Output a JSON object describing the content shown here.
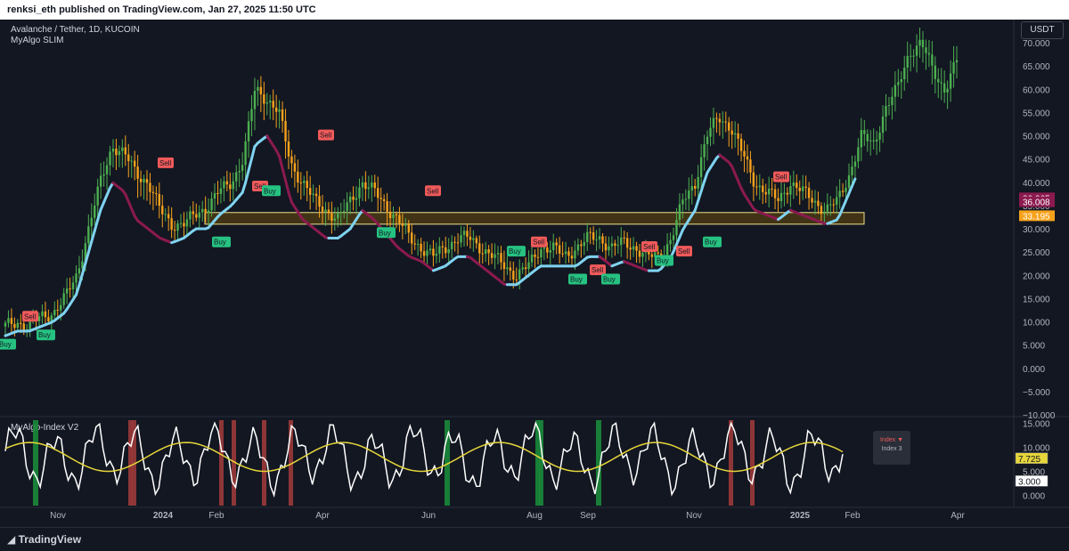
{
  "header": {
    "published": "renksi_eth published on TradingView.com, Jan 27, 2025 11:50 UTC"
  },
  "symbol": {
    "title": "Avalanche / Tether, 1D, KUCOIN",
    "indicator": "MyAlgo SLIM"
  },
  "currency_button": "USDT",
  "footer": {
    "brand": "TradingView"
  },
  "colors": {
    "bull": "#4caf50",
    "bear": "#f7a21b",
    "buy": "#26c281",
    "sell": "#f05a5a",
    "band_up": "#7fd3f0",
    "band_down": "#8b1a4f",
    "zone": "#4a3a14",
    "zone_border": "#f1e38d"
  },
  "chart_data": [
    {
      "type": "candlestick",
      "title": "Avalanche / Tether, 1D, KUCOIN",
      "ylim": [
        -10,
        75
      ],
      "y_ticks": [
        "70.000",
        "65.000",
        "60.000",
        "55.000",
        "50.000",
        "45.000",
        "40.000",
        "35.000",
        "30.000",
        "25.000",
        "20.000",
        "15.000",
        "10.000",
        "5.000",
        "0.000",
        "−5.000",
        "−10.000"
      ],
      "x_ticks": [
        "Nov",
        "2024",
        "Feb",
        "Apr",
        "Jun",
        "Aug",
        "Sep",
        "Nov",
        "2025",
        "Feb",
        "Apr"
      ],
      "price_labels": [
        {
          "value": 36.265,
          "text": "36.265",
          "color": "#8b1a4f"
        },
        {
          "value": 36.008,
          "text": "36.008",
          "color": "#8b1a4f"
        },
        {
          "value": 33.195,
          "text": "33.195",
          "color": "#f7a21b"
        }
      ],
      "support_zone": [
        31,
        33.5
      ],
      "signals": [
        {
          "label": "Sell",
          "x": 34,
          "price": 11
        },
        {
          "label": "Buy",
          "x": 50,
          "price": 7
        },
        {
          "label": "Buy",
          "x": 6,
          "price": 5
        },
        {
          "label": "Sell",
          "x": 186,
          "price": 44
        },
        {
          "label": "Buy",
          "x": 247,
          "price": 27
        },
        {
          "label": "Sell",
          "x": 292,
          "price": 39
        },
        {
          "label": "Buy",
          "x": 303,
          "price": 38
        },
        {
          "label": "Sell",
          "x": 366,
          "price": 50
        },
        {
          "label": "Buy",
          "x": 432,
          "price": 29
        },
        {
          "label": "Sell",
          "x": 486,
          "price": 38
        },
        {
          "label": "Buy",
          "x": 578,
          "price": 25
        },
        {
          "label": "Sell",
          "x": 605,
          "price": 27
        },
        {
          "label": "Buy",
          "x": 647,
          "price": 19
        },
        {
          "label": "Sell",
          "x": 671,
          "price": 21
        },
        {
          "label": "Buy",
          "x": 684,
          "price": 19
        },
        {
          "label": "Sell",
          "x": 729,
          "price": 26
        },
        {
          "label": "Buy",
          "x": 744,
          "price": 23
        },
        {
          "label": "Sell",
          "x": 768,
          "price": 25
        },
        {
          "label": "Buy",
          "x": 798,
          "price": 27
        },
        {
          "label": "Sell",
          "x": 877,
          "price": 41
        }
      ],
      "approx_closes": [
        9,
        10,
        9,
        11,
        12,
        15,
        20,
        30,
        40,
        48,
        46,
        42,
        40,
        34,
        31,
        31,
        33,
        35,
        38,
        40,
        45,
        60,
        58,
        55,
        44,
        40,
        36,
        34,
        32,
        36,
        40,
        38,
        35,
        32,
        28,
        26,
        24,
        26,
        28,
        28,
        26,
        24,
        22,
        20,
        22,
        26,
        26,
        24,
        26,
        28,
        28,
        26,
        27,
        26,
        24,
        24,
        28,
        36,
        40,
        50,
        54,
        52,
        46,
        40,
        38,
        36,
        40,
        38,
        36,
        34,
        36,
        42,
        50,
        48,
        56,
        60,
        68,
        70,
        64,
        60,
        66
      ],
      "approx_lows": [
        7,
        8,
        8,
        9,
        10,
        12,
        16,
        25,
        34,
        40,
        38,
        32,
        30,
        28,
        27,
        28,
        30,
        30,
        33,
        35,
        38,
        48,
        50,
        46,
        36,
        32,
        30,
        28,
        28,
        30,
        34,
        32,
        29,
        26,
        24,
        23,
        21,
        22,
        24,
        24,
        22,
        20,
        18,
        18,
        20,
        22,
        22,
        22,
        22,
        24,
        24,
        22,
        23,
        22,
        21,
        21,
        24,
        30,
        34,
        42,
        46,
        44,
        38,
        34,
        33,
        32,
        34,
        33,
        32,
        31,
        32,
        38,
        44,
        42,
        50,
        52,
        60,
        62,
        54,
        52,
        58
      ],
      "approx_highs": [
        11,
        12,
        11,
        13,
        14,
        18,
        24,
        36,
        46,
        50,
        50,
        46,
        42,
        38,
        34,
        34,
        36,
        40,
        42,
        44,
        50,
        66,
        62,
        60,
        48,
        44,
        40,
        38,
        36,
        40,
        44,
        42,
        38,
        34,
        30,
        28,
        27,
        30,
        30,
        30,
        28,
        27,
        26,
        24,
        26,
        28,
        28,
        28,
        28,
        30,
        30,
        28,
        30,
        28,
        27,
        26,
        32,
        40,
        46,
        54,
        56,
        56,
        50,
        44,
        42,
        40,
        44,
        42,
        39,
        37,
        40,
        46,
        54,
        52,
        60,
        66,
        74,
        74,
        70,
        66,
        74
      ]
    },
    {
      "type": "line",
      "title": "MyAlgo-Index V2",
      "ylim": [
        -1,
        16
      ],
      "y_ticks": [
        "15.000",
        "10.000",
        "5.000",
        "0.000"
      ],
      "series": [
        {
          "name": "Index",
          "color": "#ffffff",
          "last_value": 3.0
        },
        {
          "name": "Index 3",
          "color": "#e6d63a",
          "last_value": 7.725
        }
      ],
      "value_labels": [
        {
          "text": "7.725",
          "value": 7.725,
          "color": "#e6d63a"
        },
        {
          "text": "3.000",
          "value": 3.0,
          "color": "#ffffff"
        }
      ],
      "legend_items": [
        "Index ▼",
        "Index 3"
      ],
      "green_bars_x": [
        40,
        502,
        604,
        608,
        672
      ],
      "red_bars_x": [
        146,
        150,
        248,
        262,
        296,
        326,
        820,
        844
      ]
    }
  ]
}
